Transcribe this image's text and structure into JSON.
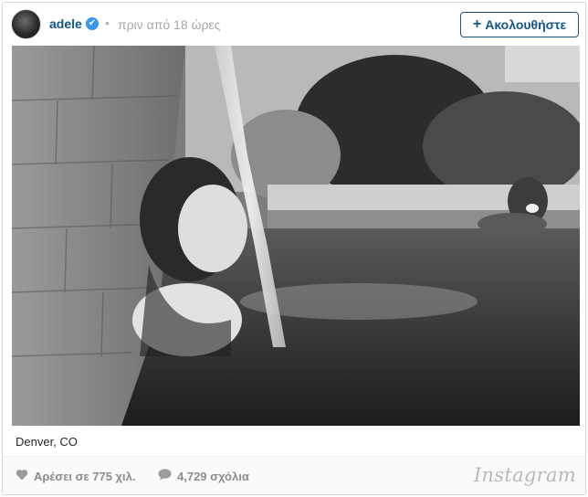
{
  "post": {
    "username": "adele",
    "verified_mark": "✔",
    "separator": "•",
    "time_ago": "πριν από 18 ώρες",
    "follow": {
      "plus": "+",
      "label": "Ακολουθήστε"
    },
    "location": "Denver, CO",
    "likes": "Αρέσει σε 775 χιλ.",
    "comments": "4,729 σχόλια",
    "brand": "Instagram"
  },
  "icons": {
    "avatar": "profile-photo",
    "verified": "verified-badge-icon",
    "like": "heart-icon",
    "comment": "speech-bubble-icon"
  },
  "colors": {
    "username": "#125688",
    "verified": "#3897f0",
    "muted": "#a5a7aa",
    "footer_bg": "#fafafa"
  }
}
